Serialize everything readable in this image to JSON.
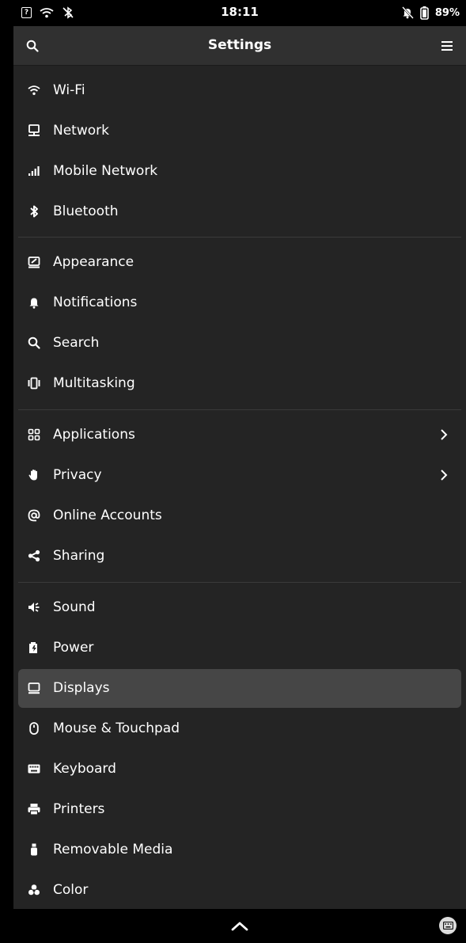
{
  "status": {
    "time": "18:11",
    "battery": "89%"
  },
  "header": {
    "title": "Settings"
  },
  "groups": [
    {
      "items": [
        {
          "label": "Wi-Fi",
          "icon": "wifi-icon"
        },
        {
          "label": "Network",
          "icon": "network-icon"
        },
        {
          "label": "Mobile Network",
          "icon": "mobile-network-icon"
        },
        {
          "label": "Bluetooth",
          "icon": "bluetooth-icon"
        }
      ]
    },
    {
      "items": [
        {
          "label": "Appearance",
          "icon": "appearance-icon"
        },
        {
          "label": "Notifications",
          "icon": "bell-icon"
        },
        {
          "label": "Search",
          "icon": "search-icon"
        },
        {
          "label": "Multitasking",
          "icon": "multitasking-icon"
        }
      ]
    },
    {
      "items": [
        {
          "label": "Applications",
          "icon": "applications-icon",
          "chevron": true
        },
        {
          "label": "Privacy",
          "icon": "hand-icon",
          "chevron": true
        },
        {
          "label": "Online Accounts",
          "icon": "at-icon"
        },
        {
          "label": "Sharing",
          "icon": "share-icon"
        }
      ]
    },
    {
      "items": [
        {
          "label": "Sound",
          "icon": "speaker-icon"
        },
        {
          "label": "Power",
          "icon": "power-icon"
        },
        {
          "label": "Displays",
          "icon": "display-icon",
          "selected": true
        },
        {
          "label": "Mouse & Touchpad",
          "icon": "mouse-icon"
        },
        {
          "label": "Keyboard",
          "icon": "keyboard-icon"
        },
        {
          "label": "Printers",
          "icon": "printer-icon"
        },
        {
          "label": "Removable Media",
          "icon": "usb-icon"
        },
        {
          "label": "Color",
          "icon": "color-icon"
        }
      ]
    }
  ],
  "colors": {
    "header_bg": "#303030",
    "list_bg": "#242424",
    "selected_bg": "#464646"
  }
}
